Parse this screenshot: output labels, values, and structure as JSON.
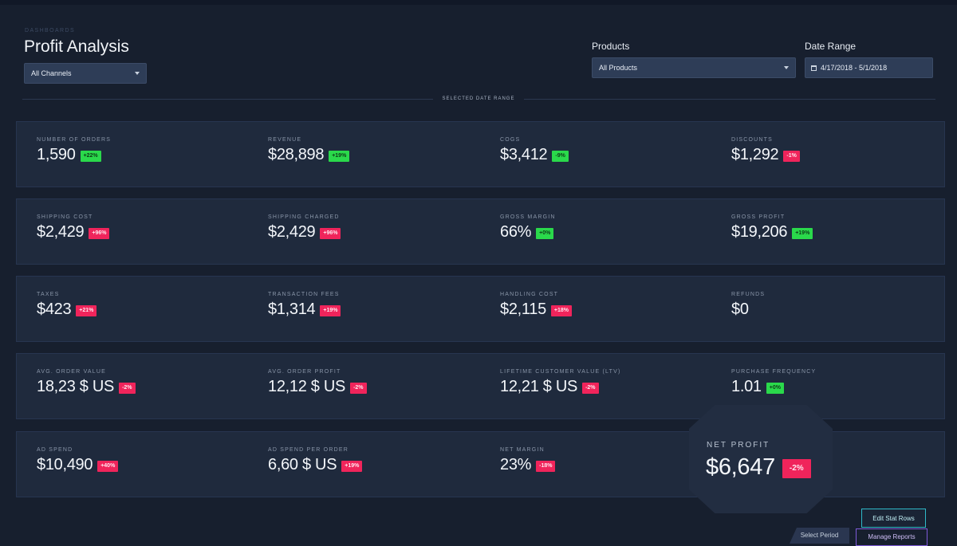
{
  "header": {
    "breadcrumb": "DASHBOARDS",
    "title": "Profit Analysis",
    "channel_select": {
      "value": "All Channels"
    },
    "products_label": "Products",
    "products_select": {
      "value": "All Products"
    },
    "date_range_label": "Date Range",
    "date_range_value": "4/17/2018 - 5/1/2018",
    "divider_label": "SELECTED DATE RANGE"
  },
  "stat_rows": [
    [
      {
        "label": "NUMBER OF ORDERS",
        "value": "1,590",
        "change": "+22%",
        "status": "positive"
      },
      {
        "label": "REVENUE",
        "value": "$28,898",
        "change": "+19%",
        "status": "positive"
      },
      {
        "label": "COGS",
        "value": "$3,412",
        "change": "-9%",
        "status": "positive"
      },
      {
        "label": "DISCOUNTS",
        "value": "$1,292",
        "change": "-1%",
        "status": "negative"
      }
    ],
    [
      {
        "label": "SHIPPING COST",
        "value": "$2,429",
        "change": "+96%",
        "status": "negative"
      },
      {
        "label": "SHIPPING CHARGED",
        "value": "$2,429",
        "change": "+96%",
        "status": "negative"
      },
      {
        "label": "GROSS MARGIN",
        "value": "66%",
        "change": "+0%",
        "status": "positive"
      },
      {
        "label": "GROSS PROFIT",
        "value": "$19,206",
        "change": "+19%",
        "status": "positive"
      }
    ],
    [
      {
        "label": "TAXES",
        "value": "$423",
        "change": "+21%",
        "status": "negative"
      },
      {
        "label": "TRANSACTION FEES",
        "value": "$1,314",
        "change": "+19%",
        "status": "negative"
      },
      {
        "label": "HANDLING COST",
        "value": "$2,115",
        "change": "+18%",
        "status": "negative"
      },
      {
        "label": "REFUNDS",
        "value": "$0",
        "change": "",
        "status": "none"
      }
    ],
    [
      {
        "label": "AVG. ORDER VALUE",
        "value": "18,23 $ US",
        "change": "-2%",
        "status": "negative"
      },
      {
        "label": "AVG. ORDER PROFIT",
        "value": "12,12 $ US",
        "change": "-2%",
        "status": "negative"
      },
      {
        "label": "LIFETIME CUSTOMER VALUE (LTV)",
        "value": "12,21 $ US",
        "change": "-2%",
        "status": "negative"
      },
      {
        "label": "PURCHASE FREQUENCY",
        "value": "1.01",
        "change": "+0%",
        "status": "positive"
      }
    ],
    [
      {
        "label": "AD SPEND",
        "value": "$10,490",
        "change": "+40%",
        "status": "negative"
      },
      {
        "label": "AD SPEND PER ORDER",
        "value": "6,60 $ US",
        "change": "+19%",
        "status": "negative"
      },
      {
        "label": "NET MARGIN",
        "value": "23%",
        "change": "-18%",
        "status": "negative"
      },
      {
        "label": "",
        "value": "",
        "change": "",
        "status": "none"
      }
    ]
  ],
  "net_profit": {
    "label": "NET PROFIT",
    "value": "$6,647",
    "change": "-2%",
    "status": "negative"
  },
  "footer": {
    "edit_label": "Edit Stat Rows",
    "tab_label": "Select Period",
    "button_label": "Manage Reports"
  },
  "colors": {
    "positive": "#2ad94b",
    "negative": "#f0245b",
    "accent": "#2fb9c9",
    "background": "#171f2e"
  }
}
